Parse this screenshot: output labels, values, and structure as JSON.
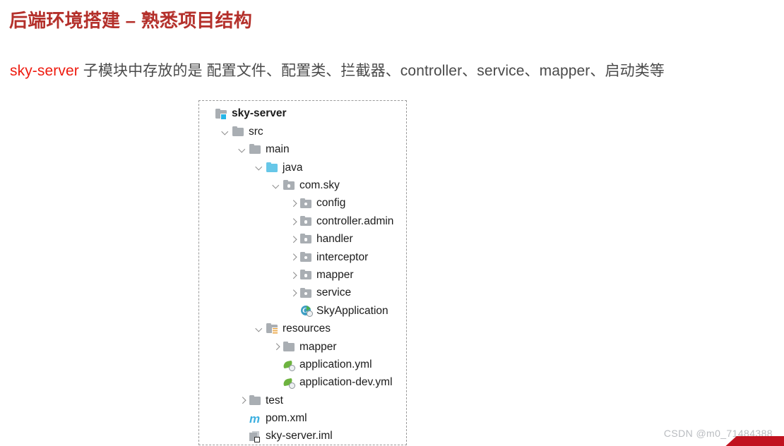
{
  "slide": {
    "title": "后端环境搭建 – 熟悉项目结构",
    "subtitle": {
      "highlight": "sky-server",
      "rest": " 子模块中存放的是 配置文件、配置类、拦截器、controller、service、mapper、启动类等"
    },
    "colors": {
      "title_red": "#b4302b",
      "highlight_red": "#ee1b0f",
      "body_gray": "#4a4a4a",
      "tree_text": "#1b1b1b",
      "folder_gray": "#a9aeb3",
      "source_root_cyan": "#67c7e8",
      "module_badge_cyan": "#27b6e8",
      "spring_green": "#6db33f",
      "maven_blue": "#3eb0e0",
      "resources_orange": "#e9a23b"
    }
  },
  "tree": {
    "nodes": [
      {
        "label": "sky-server",
        "indent": 0,
        "toggle": "none",
        "icon": "module-folder-icon",
        "bold": true
      },
      {
        "label": "src",
        "indent": 1,
        "toggle": "down",
        "icon": "folder-icon",
        "bold": false
      },
      {
        "label": "main",
        "indent": 2,
        "toggle": "down",
        "icon": "folder-icon",
        "bold": false
      },
      {
        "label": "java",
        "indent": 3,
        "toggle": "down",
        "icon": "source-root-folder-icon",
        "bold": false
      },
      {
        "label": "com.sky",
        "indent": 4,
        "toggle": "down",
        "icon": "package-icon",
        "bold": false
      },
      {
        "label": "config",
        "indent": 5,
        "toggle": "right",
        "icon": "package-icon",
        "bold": false
      },
      {
        "label": "controller.admin",
        "indent": 5,
        "toggle": "right",
        "icon": "package-icon",
        "bold": false
      },
      {
        "label": "handler",
        "indent": 5,
        "toggle": "right",
        "icon": "package-icon",
        "bold": false
      },
      {
        "label": "interceptor",
        "indent": 5,
        "toggle": "right",
        "icon": "package-icon",
        "bold": false
      },
      {
        "label": "mapper",
        "indent": 5,
        "toggle": "right",
        "icon": "package-icon",
        "bold": false
      },
      {
        "label": "service",
        "indent": 5,
        "toggle": "right",
        "icon": "package-icon",
        "bold": false
      },
      {
        "label": "SkyApplication",
        "indent": 5,
        "toggle": "none",
        "icon": "java-class-run-icon",
        "bold": false
      },
      {
        "label": "resources",
        "indent": 3,
        "toggle": "down",
        "icon": "resources-folder-icon",
        "bold": false
      },
      {
        "label": "mapper",
        "indent": 4,
        "toggle": "right",
        "icon": "folder-icon",
        "bold": false
      },
      {
        "label": "application.yml",
        "indent": 4,
        "toggle": "none",
        "icon": "spring-yml-icon",
        "bold": false
      },
      {
        "label": "application-dev.yml",
        "indent": 4,
        "toggle": "none",
        "icon": "spring-yml-icon",
        "bold": false
      },
      {
        "label": "test",
        "indent": 2,
        "toggle": "right",
        "icon": "folder-icon",
        "bold": false
      },
      {
        "label": "pom.xml",
        "indent": 2,
        "toggle": "none",
        "icon": "maven-icon",
        "bold": false
      },
      {
        "label": "sky-server.iml",
        "indent": 2,
        "toggle": "none",
        "icon": "iml-module-file-icon",
        "bold": false
      }
    ]
  },
  "watermark": {
    "text": "CSDN @m0_71484388"
  }
}
